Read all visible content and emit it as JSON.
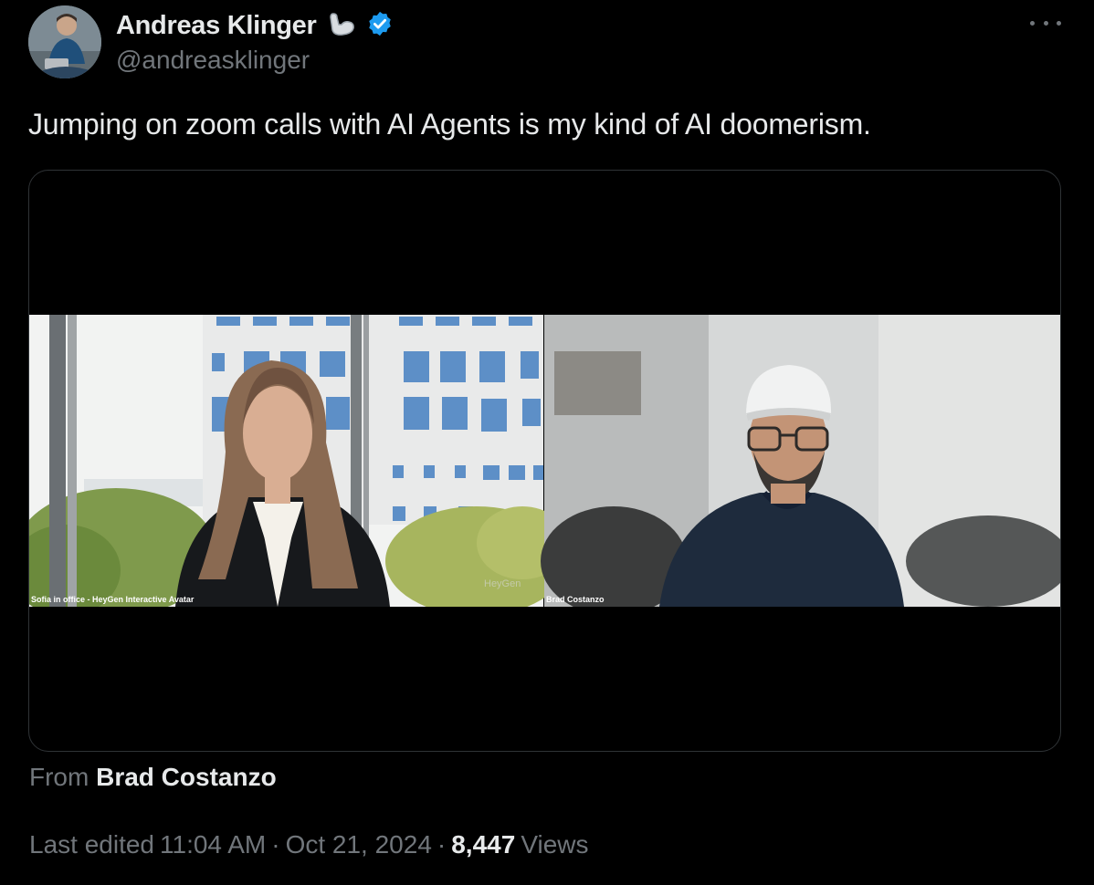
{
  "author": {
    "display_name": "Andreas Klinger",
    "handle": "@andreasklinger",
    "emoji_icon": "flexed-biceps-emoji",
    "verified_badge": "verified-badge-icon"
  },
  "tweet": {
    "text": "Jumping on zoom calls with AI Agents is my kind of AI doomerism."
  },
  "video": {
    "left_tile_label": "Sofia in office - HeyGen Interactive Avatar",
    "left_watermark": "HeyGen",
    "right_tile_label": "Brad Costanzo"
  },
  "source": {
    "prefix": "From",
    "name": "Brad Costanzo"
  },
  "meta": {
    "edited_label": "Last edited",
    "time": "11:04 AM",
    "separator": "·",
    "date": "Oct 21, 2024",
    "views_count": "8,447",
    "views_label": "Views"
  },
  "colors": {
    "background": "#000000",
    "text_primary": "#e7e9ea",
    "text_secondary": "#71767b",
    "verified_blue": "#1d9bf0",
    "border": "#2f3336"
  }
}
